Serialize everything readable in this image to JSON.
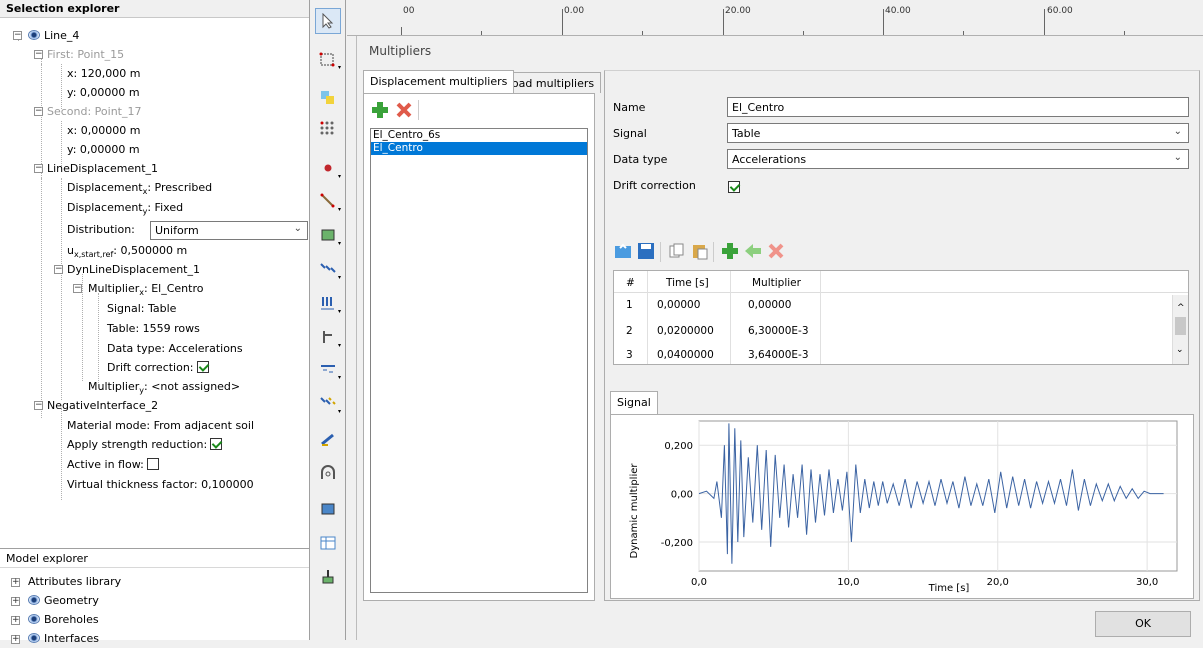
{
  "selection_explorer": {
    "title": "Selection explorer",
    "line_name": "Line_4",
    "first_point": "First: Point_15",
    "first_x": "x: 120,000 m",
    "first_y": "y: 0,00000 m",
    "second_point": "Second: Point_17",
    "second_x": "x: 0,00000 m",
    "second_y": "y: 0,00000 m",
    "line_displacement": "LineDisplacement_1",
    "displacement_x_pre": "Displacement",
    "displacement_x_sub": "x",
    "displacement_x_val": ": Prescribed",
    "displacement_y_pre": "Displacement",
    "displacement_y_sub": "y",
    "displacement_y_val": ": Fixed",
    "distribution_label": "Distribution:",
    "distribution_value": "Uniform",
    "u_pre": "u",
    "u_sub": "x,start,ref",
    "u_val": ": 0,500000 m",
    "dyn_line_displacement": "DynLineDisplacement_1",
    "multiplier_x_pre": "Multiplier",
    "multiplier_x_sub": "x",
    "multiplier_x_val": ": El_Centro",
    "signal": "Signal: Table",
    "table": "Table: 1559 rows",
    "data_type": "Data type: Accelerations",
    "drift_correction": "Drift correction:",
    "multiplier_y_pre": "Multiplier",
    "multiplier_y_sub": "y",
    "multiplier_y_val": ": <not assigned>",
    "negative_interface": "NegativeInterface_2",
    "material_mode": "Material mode: From adjacent soil",
    "apply_strength": "Apply strength reduction:",
    "active_in_flow": "Active in flow:",
    "virtual_thickness": "Virtual thickness factor: 0,100000"
  },
  "model_explorer": {
    "title": "Model explorer",
    "items": [
      "Attributes library",
      "Geometry",
      "Boreholes",
      "Interfaces"
    ]
  },
  "ruler": {
    "labels": [
      "00",
      "0.00",
      "20.00",
      "40.00",
      "60.00"
    ]
  },
  "dialog": {
    "title": "Multipliers",
    "tabs": [
      "Displacement multipliers",
      "Load multipliers"
    ],
    "multipliers": [
      "El_Centro_6s",
      "El_Centro"
    ],
    "name_label": "Name",
    "name_value": "El_Centro",
    "signal_label": "Signal",
    "signal_value": "Table",
    "data_type_label": "Data type",
    "data_type_value": "Accelerations",
    "drift_label": "Drift correction",
    "table_headers": [
      "#",
      "Time [s]",
      "Multiplier"
    ],
    "table_rows": [
      [
        "1",
        "0,00000",
        "0,00000"
      ],
      [
        "2",
        "0,0200000",
        "6,30000E-3"
      ],
      [
        "3",
        "0,0400000",
        "3,64000E-3"
      ]
    ],
    "signal_tab": "Signal",
    "ok_label": "OK"
  },
  "chart_data": {
    "type": "line",
    "title": "",
    "xlabel": "Time [s]",
    "ylabel": "Dynamic multiplier",
    "xlim": [
      0,
      32
    ],
    "ylim": [
      -0.32,
      0.3
    ],
    "xticks": [
      "0,0",
      "10,0",
      "20,0",
      "30,0"
    ],
    "yticks": [
      "0,200",
      "0,00",
      "-0,200"
    ],
    "grid": true,
    "color": "#3b63a3",
    "series": [
      {
        "x": [
          0,
          0.5,
          1.0,
          1.2,
          1.5,
          1.7,
          1.9,
          2.0,
          2.2,
          2.4,
          2.6,
          2.8,
          3.0,
          3.3,
          3.6,
          3.9,
          4.2,
          4.5,
          4.8,
          5.1,
          5.4,
          5.7,
          6.0,
          6.3,
          6.6,
          6.9,
          7.2,
          7.5,
          7.8,
          8.1,
          8.4,
          8.7,
          9.0,
          9.3,
          9.6,
          9.9,
          10.2,
          10.5,
          10.8,
          11.1,
          11.4,
          11.7,
          12.0,
          12.3,
          12.6,
          13.0,
          13.4,
          13.8,
          14.2,
          14.6,
          15.0,
          15.4,
          15.8,
          16.2,
          16.6,
          17.0,
          17.4,
          17.8,
          18.2,
          18.6,
          19.0,
          19.4,
          19.8,
          20.2,
          20.6,
          21.0,
          21.4,
          21.8,
          22.2,
          22.6,
          23.0,
          23.4,
          23.8,
          24.2,
          24.6,
          25.0,
          25.4,
          25.8,
          26.2,
          26.6,
          27.0,
          27.4,
          27.8,
          28.2,
          28.6,
          29.0,
          29.4,
          29.8,
          30.2,
          30.6,
          31.1
        ],
        "y": [
          0,
          0.01,
          -0.02,
          0.05,
          -0.1,
          0.2,
          -0.25,
          0.29,
          -0.29,
          0.27,
          -0.2,
          0.22,
          -0.18,
          0.15,
          -0.12,
          0.2,
          -0.15,
          0.18,
          -0.22,
          0.16,
          -0.1,
          0.12,
          -0.14,
          0.08,
          -0.1,
          0.12,
          -0.17,
          0.1,
          -0.12,
          0.08,
          -0.09,
          0.1,
          -0.08,
          0.06,
          -0.07,
          0.09,
          -0.2,
          0.12,
          -0.08,
          0.06,
          -0.06,
          0.05,
          -0.05,
          0.05,
          -0.04,
          0.04,
          -0.05,
          0.06,
          -0.06,
          0.05,
          -0.04,
          0.05,
          -0.05,
          0.06,
          -0.04,
          0.05,
          -0.06,
          0.07,
          -0.05,
          0.04,
          -0.05,
          0.06,
          -0.08,
          0.09,
          -0.06,
          0.07,
          -0.05,
          0.06,
          -0.06,
          0.05,
          -0.04,
          0.05,
          -0.04,
          0.06,
          -0.05,
          0.1,
          -0.07,
          0.06,
          -0.05,
          0.04,
          -0.03,
          0.04,
          -0.03,
          0.03,
          -0.02,
          0.02,
          -0.02,
          0.01,
          0,
          0,
          0
        ]
      }
    ]
  }
}
